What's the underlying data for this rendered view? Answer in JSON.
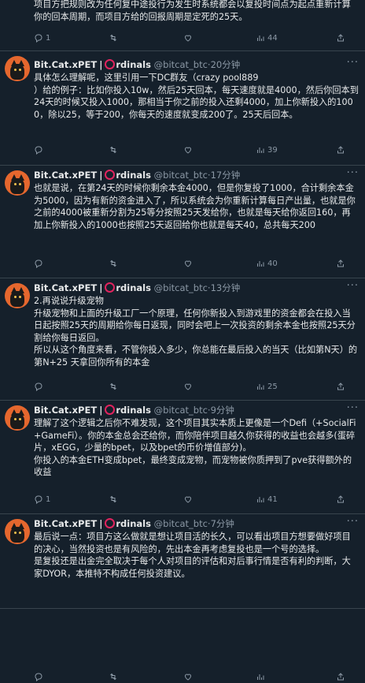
{
  "top": {
    "text": "项目方把规则改为任何复中途投行为发生时系统都会以复投时间点为起点重新计算你的回本周期，而项目方给的回报周期是定死的25天。",
    "actions": {
      "replies": "1",
      "retweets": "",
      "likes": "",
      "views": "44"
    }
  },
  "tweets": [
    {
      "name": "Bit.Cat.xPET",
      "ordinals": "rdinals",
      "handle": "@bitcat_btc",
      "time": "20分钟",
      "text": "具体怎么理解呢，这里引用一下DC群友（crazy pool889\n）给的例子：比如你投入10w，然后25天回本，每天速度就是4000，然后你回本到24天的时候又投入1000，那相当于你之前的投入还剩4000，加上你新投入的1000，除以25，等于200，你每天的速度就变成200了。25天后回本。",
      "actions": {
        "replies": "",
        "retweets": "",
        "likes": "",
        "views": "39"
      }
    },
    {
      "name": "Bit.Cat.xPET",
      "ordinals": "rdinals",
      "handle": "@bitcat_btc",
      "time": "17分钟",
      "text": "也就是说，在第24天的时候你剩余本金4000，但是你复投了1000，合计剩余本金为5000，因为有新的资金进入了，所以系统会为你重新计算每日产出量，也就是你之前的4000被重新分割为25等分按照25天发给你，也就是每天给你返回160，再加上你新投入的1000也按照25天返回给你也就是每天40，总共每天200",
      "actions": {
        "replies": "",
        "retweets": "",
        "likes": "",
        "views": "40"
      }
    },
    {
      "name": "Bit.Cat.xPET",
      "ordinals": "rdinals",
      "handle": "@bitcat_btc",
      "time": "13分钟",
      "text": "2.再说说升级宠物\n升级宠物和上面的升级工厂一个原理，任何你新投入到游戏里的资金都会在投入当日起按照25天的周期给你每日返现，同时会吧上一次投资的剩余本金也按照25天分割给你每日返回。\n所以从这个角度来看，不管你投入多少，你总能在最后投入的当天（比如第N天）的 第N+25 天拿回你所有的本金",
      "actions": {
        "replies": "",
        "retweets": "",
        "likes": "",
        "views": "25"
      }
    },
    {
      "name": "Bit.Cat.xPET",
      "ordinals": "rdinals",
      "handle": "@bitcat_btc",
      "time": "9分钟",
      "text": "理解了这个逻辑之后你不难发现，这个项目其实本质上更像是一个Defi（+SocialFi+GameFi）。你的本金总会还给你，而你陪伴项目越久你获得的收益也会越多(蛋碎片，xEGG，少量的bpet，以及bpet的币价增值部分)。\n你投入的本金ETH变成bpet，最终变成宠物，而宠物被你质押到了pve获得额外的收益",
      "actions": {
        "replies": "1",
        "retweets": "",
        "likes": "",
        "views": "41"
      }
    },
    {
      "name": "Bit.Cat.xPET",
      "ordinals": "rdinals",
      "handle": "@bitcat_btc",
      "time": "7分钟",
      "text": "最后说一点：项目方这么做就是想让项目活的长久，可以看出项目方想要做好项目的决心，当然投资也是有风险的，先出本金再考虑复投也是一个号的选择。\n是复投还是出金完全取决于每个人对项目的评估和对后事行情是否有利的判断，大家DYOR，本推特不构成任何投资建议。",
      "actions": {
        "replies": "",
        "retweets": "",
        "likes": "",
        "views": ""
      }
    }
  ],
  "icons": {
    "reply": "reply-icon",
    "retweet": "retweet-icon",
    "like": "heart-icon",
    "views": "views-icon",
    "share": "share-icon",
    "more": "more-icon",
    "ordinals": "ordinals-circle-icon"
  },
  "colors": {
    "background": "#15202b",
    "text": "#e7e9ea",
    "muted": "#8b98a5",
    "ordinals_ring": "#e0245e",
    "avatar": "#e5672e"
  }
}
